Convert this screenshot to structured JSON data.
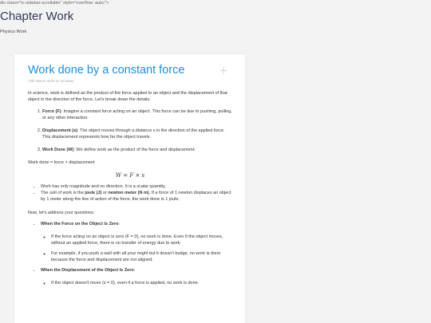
{
  "raw_text": "div class=\"tc-sidebar-scrollable\" style=\"overflow: auto;\">",
  "page": {
    "title": "Chapter Work",
    "subtitle": "Physics Work"
  },
  "post": {
    "title": "Work done by a constant force",
    "date": "13th March 2024 at 10:33am",
    "intro": "In science, work is defined as the product of the force applied to an object and the displacement of that object in the direction of the force. Let's break down the details:",
    "list": [
      {
        "term": "Force (F)",
        "text": ": Imagine a constant force acting on an object. This force can be due to pushing, pulling, or any other interaction."
      },
      {
        "term": "Displacement (s)",
        "text": ": The object moves through a distance s in the direction of the applied force. This displacement represents how far the object travels."
      },
      {
        "term": "Work Done (W)",
        "text": ": We define work as the product of the force and displacement:"
      }
    ],
    "formula_text": "Work done = force × displacement",
    "formula": "W = F × s",
    "bullet1": "Work has only magnitude and no direction. It is a scalar quantity.",
    "bullet2_pre": "The unit of work is the ",
    "bullet2_joule": "joule (J)",
    "bullet2_mid": " or ",
    "bullet2_nm": "newton meter (N m)",
    "bullet2_post": ". If a force of 1 newton displaces an object by 1 meter along the line of action of the force, the work done is 1 joule.",
    "questions_intro": "Now, let's address your questions:",
    "q1": "When the Force on the Object Is Zero",
    "q1_a": "If the force acting on an object is zero (F = 0), no work is done. Even if the object moves, without an applied force, there is no transfer of energy due to work.",
    "q1_b": "For example, if you push a wall with all your might but it doesn't budge, no work is done because the force and displacement are not aligned.",
    "q2": "When the Displacement of the Object Is Zero",
    "q2_a": "If the object doesn't move (s = 0), even if a force is applied, no work is done."
  }
}
